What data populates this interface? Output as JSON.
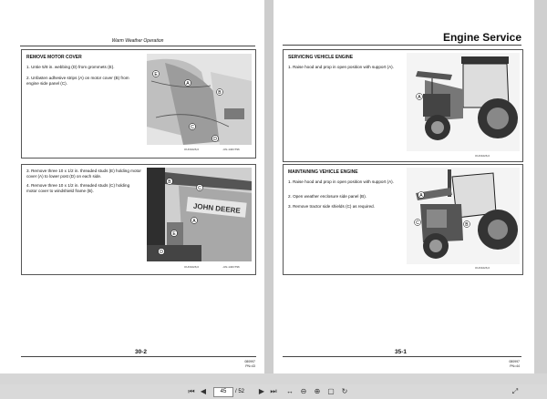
{
  "viewer": {
    "current_page": "45",
    "total_pages": "/ 52",
    "icons": [
      "first-page-icon",
      "prev-page-icon",
      "next-page-icon",
      "last-page-icon",
      "fit-width-icon",
      "zoom-out-icon",
      "zoom-in-icon",
      "fit-page-icon",
      "rotate-icon",
      "expand-icon"
    ]
  },
  "left_page": {
    "running_head": "Warm Weather Operation",
    "box1": {
      "title": "REMOVE MOTOR COVER",
      "step1": "1. Untie 5/8 in. webbing (D) from grommets (E).",
      "step2": "2. Unfasten adhesive strips (A) on motor cover (B) from engine side panel (C).",
      "fig_id_a": "OUO1026,0",
      "fig_id_b": "-UN-140CT96",
      "callouts": [
        "A",
        "B",
        "C",
        "D",
        "E"
      ]
    },
    "box2": {
      "step3": "3. Remove three 10 x 1/2 in. threaded studs (E) holding motor cover (A) to lower post (D) on each side.",
      "step4": "4. Remove three 10 x 1/2 in. threaded studs (C) holding motor cover to windshield frame (B).",
      "fig_id_a": "OUO1026,0",
      "fig_id_b": "-UN-140CT96",
      "brand_text": "JOHN DEERE",
      "callouts": [
        "A",
        "B",
        "C",
        "D",
        "E"
      ]
    },
    "page_number": "30-2",
    "footer_small": [
      "080997",
      "PN=43"
    ]
  },
  "right_page": {
    "section_title": "Engine Service",
    "box1": {
      "title": "SERVICING VEHICLE ENGINE",
      "step1": "1. Raise hood and prop in open position with support (A).",
      "fig_id": "OUO1026,0",
      "callouts": [
        "A"
      ]
    },
    "box2": {
      "title": "MAINTAINING VEHICLE ENGINE",
      "step1": "1. Raise hood and prop in open position with support (A).",
      "step2": "2. Open weather enclosure side panel (B).",
      "step3": "3. Remove tractor side shields (C) as required.",
      "fig_id": "OUO1026,0",
      "callouts": [
        "A",
        "B",
        "C"
      ]
    },
    "page_number": "35-1",
    "footer_small": [
      "080997",
      "PN=44"
    ]
  }
}
